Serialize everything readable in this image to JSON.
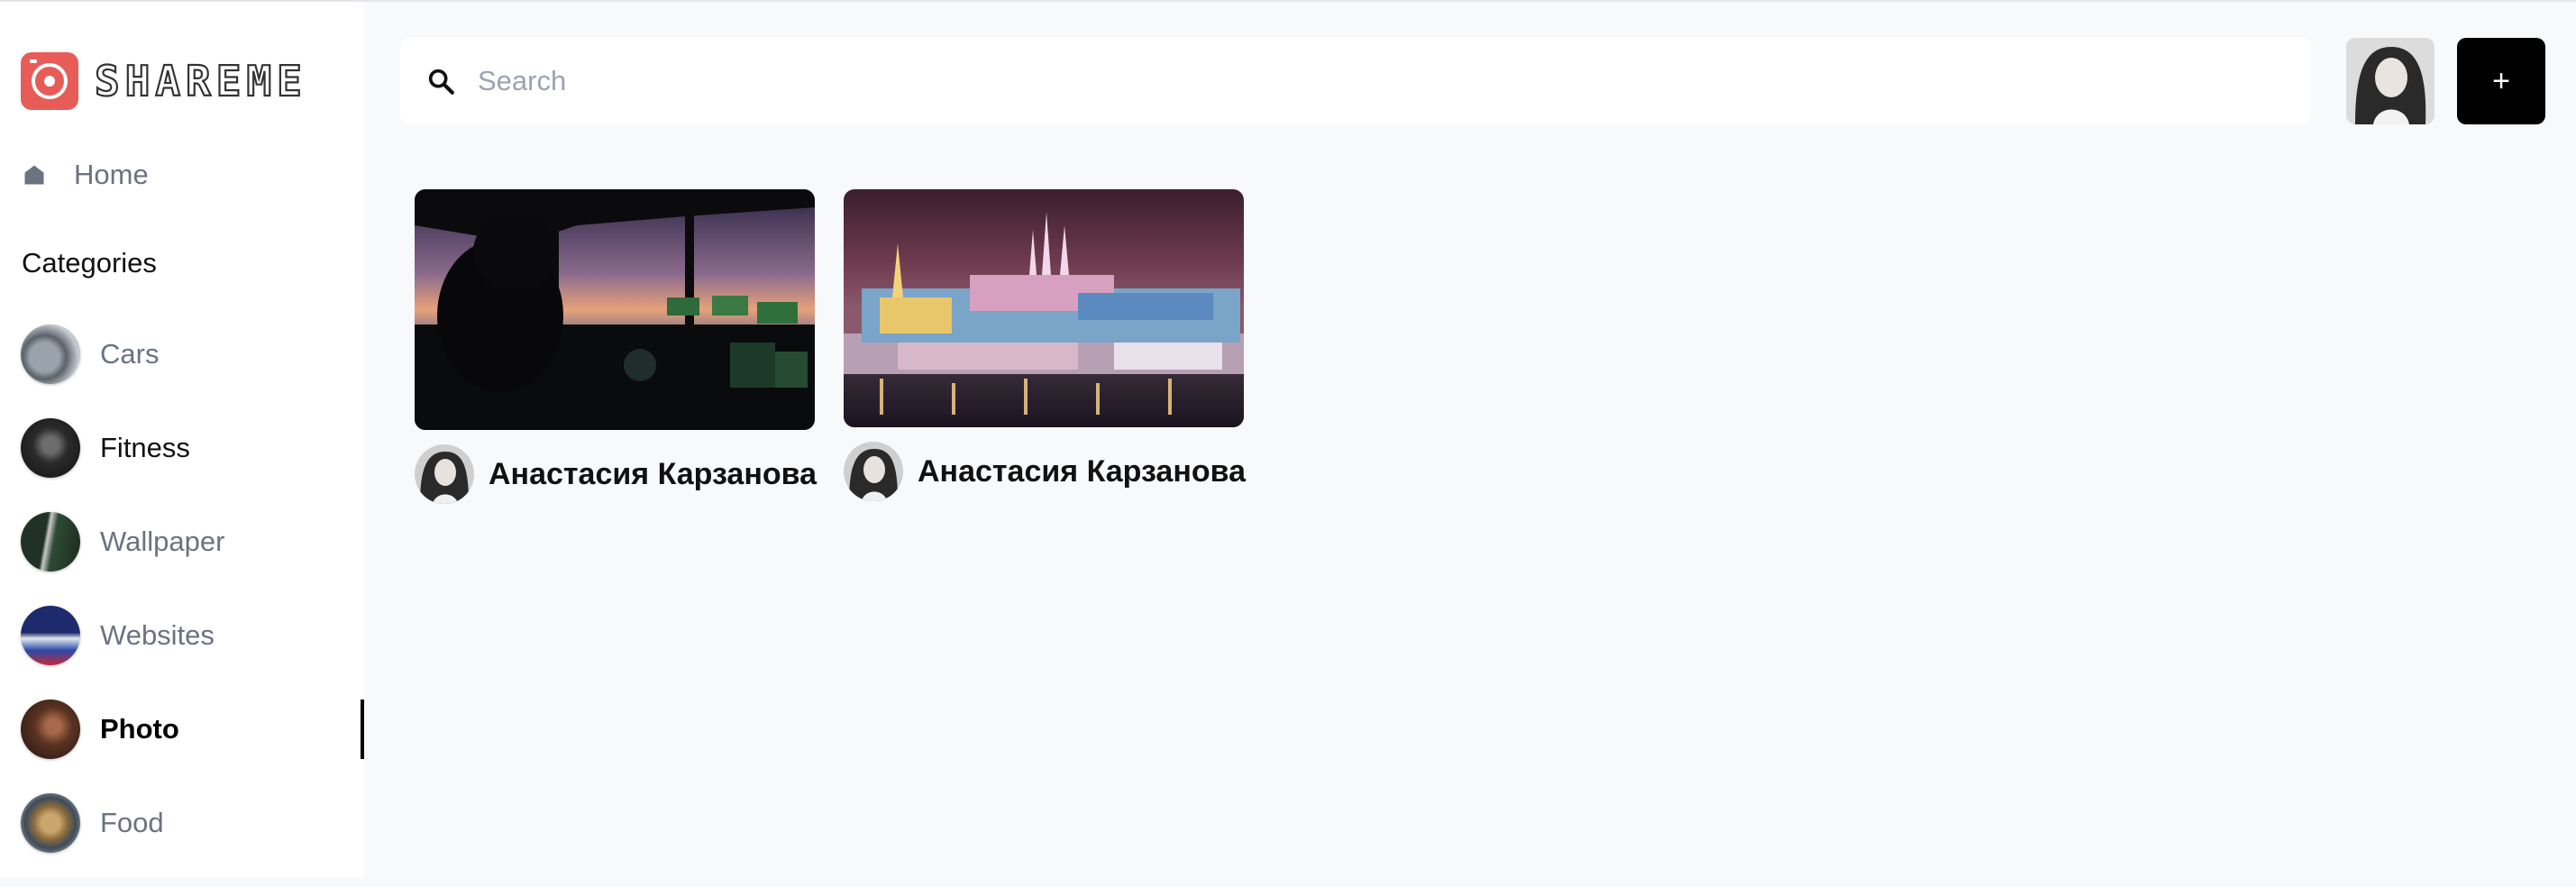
{
  "app": {
    "logo_text": "SHAREME"
  },
  "nav": {
    "home_label": "Home"
  },
  "categories": {
    "heading": "Categories",
    "items": [
      {
        "label": "Cars"
      },
      {
        "label": "Fitness"
      },
      {
        "label": "Wallpaper"
      },
      {
        "label": "Websites"
      },
      {
        "label": "Photo",
        "active": true
      },
      {
        "label": "Food"
      }
    ]
  },
  "search": {
    "placeholder": "Search",
    "value": ""
  },
  "header": {
    "add_label": "+"
  },
  "pins": [
    {
      "author": "Анастасия Карзанова",
      "image": "cockpit-photo"
    },
    {
      "author": "Анастасия Карзанова",
      "image": "prague-castle-photo"
    }
  ],
  "colors": {
    "accent": "#e85c57",
    "background": "#f8f9fb",
    "sidebar": "#ffffff",
    "add_button": "#000000"
  }
}
